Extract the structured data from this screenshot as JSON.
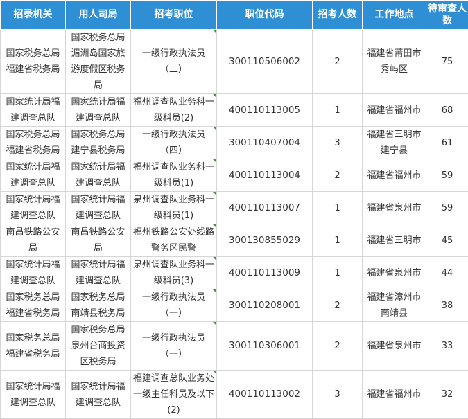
{
  "headers": [
    "招录机关",
    "用人司局",
    "招考职位",
    "职位代码",
    "招考人数",
    "工作地点",
    "待审查人数"
  ],
  "rows": [
    {
      "agency": "国家税务总局福建省税务局",
      "unit": "国家税务总局湄洲岛国家旅游度假区税务局",
      "position": "一级行政执法员（二）",
      "code": "300110506002",
      "count": "2",
      "location": "福建省莆田市秀屿区",
      "pending": "75"
    },
    {
      "agency": "国家统计局福建调查总队",
      "unit": "国家统计局福建调查总队",
      "position": "福州调查队业务科一级科员(2)",
      "code": "400110113005",
      "count": "1",
      "location": "福建省福州市",
      "pending": "68"
    },
    {
      "agency": "国家税务总局福建省税务局",
      "unit": "国家税务总局建宁县税务局",
      "position": "一级行政执法员（四）",
      "code": "300110407004",
      "count": "3",
      "location": "福建省三明市建宁县",
      "pending": "61"
    },
    {
      "agency": "国家统计局福建调查总队",
      "unit": "国家统计局福建调查总队",
      "position": "福州调查队业务科一级科员(1)",
      "code": "400110113004",
      "count": "2",
      "location": "福建省福州市",
      "pending": "59"
    },
    {
      "agency": "国家统计局福建调查总队",
      "unit": "国家统计局福建调查总队",
      "position": "泉州调查队业务科一级科员(1)",
      "code": "400110113007",
      "count": "1",
      "location": "福建省泉州市",
      "pending": "59"
    },
    {
      "agency": "南昌铁路公安局",
      "unit": "南昌铁路公安局",
      "position": "福州铁路公安处线路警务区民警",
      "code": "300130855029",
      "count": "1",
      "location": "福建省三明市",
      "pending": "45"
    },
    {
      "agency": "国家统计局福建调查总队",
      "unit": "国家统计局福建调查总队",
      "position": "泉州调查队业务科一级科员(3)",
      "code": "400110113009",
      "count": "1",
      "location": "福建省泉州市",
      "pending": "44"
    },
    {
      "agency": "国家税务总局福建省税务局",
      "unit": "国家税务总局南靖县税务局",
      "position": "一级行政执法员（一）",
      "code": "300110208001",
      "count": "2",
      "location": "福建省漳州市南靖县",
      "pending": "38"
    },
    {
      "agency": "国家税务总局福建省税务局",
      "unit": "国家税务总局泉州台商投资区税务局",
      "position": "一级行政执法员（一）",
      "code": "300110306001",
      "count": "2",
      "location": "福建省泉州市",
      "pending": "33"
    },
    {
      "agency": "国家统计局福建调查总队",
      "unit": "国家统计局福建调查总队",
      "position": "福建调查总队业务处一级主任科员及以下(2)",
      "code": "400110113002",
      "count": "3",
      "location": "福建省福州市",
      "pending": "32"
    }
  ],
  "colors": {
    "header_bg": "#2e8fd4",
    "header_text": "#ffffff",
    "border": "#d6d6d6",
    "text": "#333333",
    "flag": "#3a9a3a"
  }
}
